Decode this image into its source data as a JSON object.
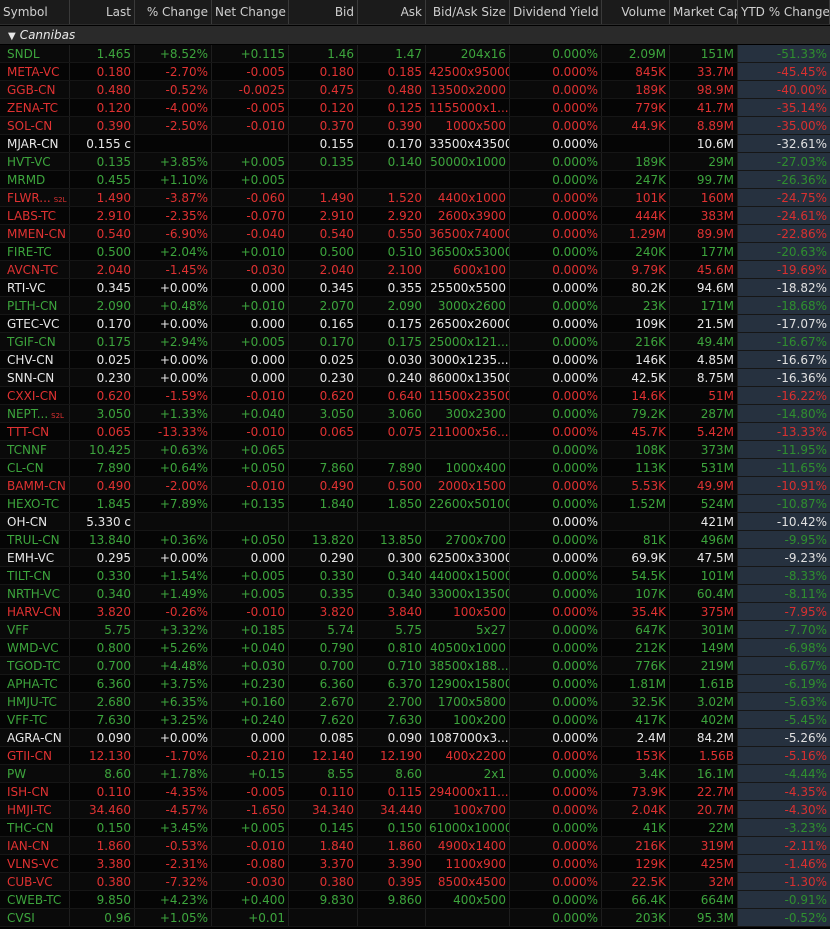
{
  "columns": [
    "Symbol",
    "Last",
    "% Change",
    "Net Change",
    "Bid",
    "Ask",
    "Bid/Ask Size",
    "Dividend Yield",
    "Volume",
    "Market Cap",
    "YTD % Change"
  ],
  "group": {
    "label": "Cannibas",
    "icon": "collapse-triangle-icon"
  },
  "colors": {
    "up": "#3da53d",
    "down": "#e03232",
    "flat": "#e8e8e8",
    "ytd_bg": "#26313f"
  },
  "rows": [
    {
      "s": "SNDL",
      "last": "1.465",
      "pct": "+8.52%",
      "net": "+0.115",
      "bid": "1.46",
      "ask": "1.47",
      "size": "204x16",
      "div": "0.000%",
      "vol": "2.09M",
      "cap": "151M",
      "ytd": "-51.33%",
      "d": "up"
    },
    {
      "s": "META-VC",
      "last": "0.180",
      "pct": "-2.70%",
      "net": "-0.005",
      "bid": "0.180",
      "ask": "0.185",
      "size": "42500x95000",
      "div": "0.000%",
      "vol": "845K",
      "cap": "33.7M",
      "ytd": "-45.45%",
      "d": "dn"
    },
    {
      "s": "GGB-CN",
      "last": "0.480",
      "pct": "-0.52%",
      "net": "-0.0025",
      "bid": "0.475",
      "ask": "0.480",
      "size": "13500x2000",
      "div": "0.000%",
      "vol": "189K",
      "cap": "98.9M",
      "ytd": "-40.00%",
      "d": "dn"
    },
    {
      "s": "ZENA-TC",
      "last": "0.120",
      "pct": "-4.00%",
      "net": "-0.005",
      "bid": "0.120",
      "ask": "0.125",
      "size": "1155000x1...",
      "div": "0.000%",
      "vol": "779K",
      "cap": "41.7M",
      "ytd": "-35.14%",
      "d": "dn"
    },
    {
      "s": "SOL-CN",
      "last": "0.390",
      "pct": "-2.50%",
      "net": "-0.010",
      "bid": "0.370",
      "ask": "0.390",
      "size": "1000x500",
      "div": "0.000%",
      "vol": "44.9K",
      "cap": "8.89M",
      "ytd": "-35.00%",
      "d": "dn"
    },
    {
      "s": "MJAR-CN",
      "last": "0.155 c",
      "pct": "",
      "net": "",
      "bid": "0.155",
      "ask": "0.170",
      "size": "33500x43500",
      "div": "0.000%",
      "vol": "",
      "cap": "10.6M",
      "ytd": "-32.61%",
      "d": "fl"
    },
    {
      "s": "HVT-VC",
      "last": "0.135",
      "pct": "+3.85%",
      "net": "+0.005",
      "bid": "0.135",
      "ask": "0.140",
      "size": "50000x1000",
      "div": "0.000%",
      "vol": "189K",
      "cap": "29M",
      "ytd": "-27.03%",
      "d": "up"
    },
    {
      "s": "MRMD",
      "last": "0.455",
      "pct": "+1.10%",
      "net": "+0.005",
      "bid": "",
      "ask": "",
      "size": "",
      "div": "0.000%",
      "vol": "247K",
      "cap": "99.7M",
      "ytd": "-26.36%",
      "d": "up"
    },
    {
      "s": "FLWR...",
      "tag": "S2L",
      "last": "1.490",
      "pct": "-3.87%",
      "net": "-0.060",
      "bid": "1.490",
      "ask": "1.520",
      "size": "4400x1000",
      "div": "0.000%",
      "vol": "101K",
      "cap": "160M",
      "ytd": "-24.75%",
      "d": "dn"
    },
    {
      "s": "LABS-TC",
      "last": "2.910",
      "pct": "-2.35%",
      "net": "-0.070",
      "bid": "2.910",
      "ask": "2.920",
      "size": "2600x3900",
      "div": "0.000%",
      "vol": "444K",
      "cap": "383M",
      "ytd": "-24.61%",
      "d": "dn"
    },
    {
      "s": "MMEN-CN",
      "last": "0.540",
      "pct": "-6.90%",
      "net": "-0.040",
      "bid": "0.540",
      "ask": "0.550",
      "size": "36500x74000",
      "div": "0.000%",
      "vol": "1.29M",
      "cap": "89.9M",
      "ytd": "-22.86%",
      "d": "dn"
    },
    {
      "s": "FIRE-TC",
      "last": "0.500",
      "pct": "+2.04%",
      "net": "+0.010",
      "bid": "0.500",
      "ask": "0.510",
      "size": "36500x53000",
      "div": "0.000%",
      "vol": "240K",
      "cap": "177M",
      "ytd": "-20.63%",
      "d": "up"
    },
    {
      "s": "AVCN-TC",
      "last": "2.040",
      "pct": "-1.45%",
      "net": "-0.030",
      "bid": "2.040",
      "ask": "2.100",
      "size": "600x100",
      "div": "0.000%",
      "vol": "9.79K",
      "cap": "45.6M",
      "ytd": "-19.69%",
      "d": "dn"
    },
    {
      "s": "RTI-VC",
      "last": "0.345",
      "pct": "+0.00%",
      "net": "0.000",
      "bid": "0.345",
      "ask": "0.355",
      "size": "25500x5500",
      "div": "0.000%",
      "vol": "80.2K",
      "cap": "94.6M",
      "ytd": "-18.82%",
      "d": "fl"
    },
    {
      "s": "PLTH-CN",
      "last": "2.090",
      "pct": "+0.48%",
      "net": "+0.010",
      "bid": "2.070",
      "ask": "2.090",
      "size": "3000x2600",
      "div": "0.000%",
      "vol": "23K",
      "cap": "171M",
      "ytd": "-18.68%",
      "d": "up"
    },
    {
      "s": "GTEC-VC",
      "last": "0.170",
      "pct": "+0.00%",
      "net": "0.000",
      "bid": "0.165",
      "ask": "0.175",
      "size": "26500x26000",
      "div": "0.000%",
      "vol": "109K",
      "cap": "21.5M",
      "ytd": "-17.07%",
      "d": "fl"
    },
    {
      "s": "TGIF-CN",
      "last": "0.175",
      "pct": "+2.94%",
      "net": "+0.005",
      "bid": "0.170",
      "ask": "0.175",
      "size": "25000x121...",
      "div": "0.000%",
      "vol": "216K",
      "cap": "49.4M",
      "ytd": "-16.67%",
      "d": "up"
    },
    {
      "s": "CHV-CN",
      "last": "0.025",
      "pct": "+0.00%",
      "net": "0.000",
      "bid": "0.025",
      "ask": "0.030",
      "size": "3000x1235...",
      "div": "0.000%",
      "vol": "146K",
      "cap": "4.85M",
      "ytd": "-16.67%",
      "d": "fl"
    },
    {
      "s": "SNN-CN",
      "last": "0.230",
      "pct": "+0.00%",
      "net": "0.000",
      "bid": "0.230",
      "ask": "0.240",
      "size": "86000x13500",
      "div": "0.000%",
      "vol": "42.5K",
      "cap": "8.75M",
      "ytd": "-16.36%",
      "d": "fl"
    },
    {
      "s": "CXXI-CN",
      "last": "0.620",
      "pct": "-1.59%",
      "net": "-0.010",
      "bid": "0.620",
      "ask": "0.640",
      "size": "11500x23500",
      "div": "0.000%",
      "vol": "14.6K",
      "cap": "51M",
      "ytd": "-16.22%",
      "d": "dn"
    },
    {
      "s": "NEPT...",
      "tag": "S2L",
      "last": "3.050",
      "pct": "+1.33%",
      "net": "+0.040",
      "bid": "3.050",
      "ask": "3.060",
      "size": "300x2300",
      "div": "0.000%",
      "vol": "79.2K",
      "cap": "287M",
      "ytd": "-14.80%",
      "d": "up"
    },
    {
      "s": "TTT-CN",
      "last": "0.065",
      "pct": "-13.33%",
      "net": "-0.010",
      "bid": "0.065",
      "ask": "0.075",
      "size": "211000x56...",
      "div": "0.000%",
      "vol": "45.7K",
      "cap": "5.42M",
      "ytd": "-13.33%",
      "d": "dn"
    },
    {
      "s": "TCNNF",
      "last": "10.425",
      "pct": "+0.63%",
      "net": "+0.065",
      "bid": "",
      "ask": "",
      "size": "",
      "div": "0.000%",
      "vol": "108K",
      "cap": "373M",
      "ytd": "-11.95%",
      "d": "up"
    },
    {
      "s": "CL-CN",
      "last": "7.890",
      "pct": "+0.64%",
      "net": "+0.050",
      "bid": "7.860",
      "ask": "7.890",
      "size": "1000x400",
      "div": "0.000%",
      "vol": "113K",
      "cap": "531M",
      "ytd": "-11.65%",
      "d": "up"
    },
    {
      "s": "BAMM-CN",
      "last": "0.490",
      "pct": "-2.00%",
      "net": "-0.010",
      "bid": "0.490",
      "ask": "0.500",
      "size": "2000x1500",
      "div": "0.000%",
      "vol": "5.53K",
      "cap": "49.9M",
      "ytd": "-10.91%",
      "d": "dn"
    },
    {
      "s": "HEXO-TC",
      "last": "1.845",
      "pct": "+7.89%",
      "net": "+0.135",
      "bid": "1.840",
      "ask": "1.850",
      "size": "22600x50100",
      "div": "0.000%",
      "vol": "1.52M",
      "cap": "524M",
      "ytd": "-10.87%",
      "d": "up"
    },
    {
      "s": "OH-CN",
      "last": "5.330 c",
      "pct": "",
      "net": "",
      "bid": "",
      "ask": "",
      "size": "",
      "div": "0.000%",
      "vol": "",
      "cap": "421M",
      "ytd": "-10.42%",
      "d": "fl"
    },
    {
      "s": "TRUL-CN",
      "last": "13.840",
      "pct": "+0.36%",
      "net": "+0.050",
      "bid": "13.820",
      "ask": "13.850",
      "size": "2700x700",
      "div": "0.000%",
      "vol": "81K",
      "cap": "496M",
      "ytd": "-9.95%",
      "d": "up"
    },
    {
      "s": "EMH-VC",
      "last": "0.295",
      "pct": "+0.00%",
      "net": "0.000",
      "bid": "0.290",
      "ask": "0.300",
      "size": "62500x33000",
      "div": "0.000%",
      "vol": "69.9K",
      "cap": "47.5M",
      "ytd": "-9.23%",
      "d": "fl"
    },
    {
      "s": "TILT-CN",
      "last": "0.330",
      "pct": "+1.54%",
      "net": "+0.005",
      "bid": "0.330",
      "ask": "0.340",
      "size": "44000x15000",
      "div": "0.000%",
      "vol": "54.5K",
      "cap": "101M",
      "ytd": "-8.33%",
      "d": "up"
    },
    {
      "s": "NRTH-VC",
      "last": "0.340",
      "pct": "+1.49%",
      "net": "+0.005",
      "bid": "0.335",
      "ask": "0.340",
      "size": "33000x13500",
      "div": "0.000%",
      "vol": "107K",
      "cap": "60.4M",
      "ytd": "-8.11%",
      "d": "up"
    },
    {
      "s": "HARV-CN",
      "last": "3.820",
      "pct": "-0.26%",
      "net": "-0.010",
      "bid": "3.820",
      "ask": "3.840",
      "size": "100x500",
      "div": "0.000%",
      "vol": "35.4K",
      "cap": "375M",
      "ytd": "-7.95%",
      "d": "dn"
    },
    {
      "s": "VFF",
      "last": "5.75",
      "pct": "+3.32%",
      "net": "+0.185",
      "bid": "5.74",
      "ask": "5.75",
      "size": "5x27",
      "div": "0.000%",
      "vol": "647K",
      "cap": "301M",
      "ytd": "-7.70%",
      "d": "up"
    },
    {
      "s": "WMD-VC",
      "last": "0.800",
      "pct": "+5.26%",
      "net": "+0.040",
      "bid": "0.790",
      "ask": "0.810",
      "size": "40500x1000",
      "div": "0.000%",
      "vol": "212K",
      "cap": "149M",
      "ytd": "-6.98%",
      "d": "up"
    },
    {
      "s": "TGOD-TC",
      "last": "0.700",
      "pct": "+4.48%",
      "net": "+0.030",
      "bid": "0.700",
      "ask": "0.710",
      "size": "38500x188...",
      "div": "0.000%",
      "vol": "776K",
      "cap": "219M",
      "ytd": "-6.67%",
      "d": "up"
    },
    {
      "s": "APHA-TC",
      "last": "6.360",
      "pct": "+3.75%",
      "net": "+0.230",
      "bid": "6.360",
      "ask": "6.370",
      "size": "12900x15800",
      "div": "0.000%",
      "vol": "1.81M",
      "cap": "1.61B",
      "ytd": "-6.19%",
      "d": "up"
    },
    {
      "s": "HMJU-TC",
      "last": "2.680",
      "pct": "+6.35%",
      "net": "+0.160",
      "bid": "2.670",
      "ask": "2.700",
      "size": "1700x5800",
      "div": "0.000%",
      "vol": "32.5K",
      "cap": "3.02M",
      "ytd": "-5.63%",
      "d": "up"
    },
    {
      "s": "VFF-TC",
      "last": "7.630",
      "pct": "+3.25%",
      "net": "+0.240",
      "bid": "7.620",
      "ask": "7.630",
      "size": "100x200",
      "div": "0.000%",
      "vol": "417K",
      "cap": "402M",
      "ytd": "-5.45%",
      "d": "up"
    },
    {
      "s": "AGRA-CN",
      "last": "0.090",
      "pct": "+0.00%",
      "net": "0.000",
      "bid": "0.085",
      "ask": "0.090",
      "size": "1087000x3...",
      "div": "0.000%",
      "vol": "2.4M",
      "cap": "84.2M",
      "ytd": "-5.26%",
      "d": "fl"
    },
    {
      "s": "GTII-CN",
      "last": "12.130",
      "pct": "-1.70%",
      "net": "-0.210",
      "bid": "12.140",
      "ask": "12.190",
      "size": "400x2200",
      "div": "0.000%",
      "vol": "153K",
      "cap": "1.56B",
      "ytd": "-5.16%",
      "d": "dn"
    },
    {
      "s": "PW",
      "last": "8.60",
      "pct": "+1.78%",
      "net": "+0.15",
      "bid": "8.55",
      "ask": "8.60",
      "size": "2x1",
      "div": "0.000%",
      "vol": "3.4K",
      "cap": "16.1M",
      "ytd": "-4.44%",
      "d": "up"
    },
    {
      "s": "ISH-CN",
      "last": "0.110",
      "pct": "-4.35%",
      "net": "-0.005",
      "bid": "0.110",
      "ask": "0.115",
      "size": "294000x11...",
      "div": "0.000%",
      "vol": "73.9K",
      "cap": "22.7M",
      "ytd": "-4.35%",
      "d": "dn"
    },
    {
      "s": "HMJI-TC",
      "last": "34.460",
      "pct": "-4.57%",
      "net": "-1.650",
      "bid": "34.340",
      "ask": "34.440",
      "size": "100x700",
      "div": "0.000%",
      "vol": "2.04K",
      "cap": "20.7M",
      "ytd": "-4.30%",
      "d": "dn"
    },
    {
      "s": "THC-CN",
      "last": "0.150",
      "pct": "+3.45%",
      "net": "+0.005",
      "bid": "0.145",
      "ask": "0.150",
      "size": "61000x10000",
      "div": "0.000%",
      "vol": "41K",
      "cap": "22M",
      "ytd": "-3.23%",
      "d": "up"
    },
    {
      "s": "IAN-CN",
      "last": "1.860",
      "pct": "-0.53%",
      "net": "-0.010",
      "bid": "1.840",
      "ask": "1.860",
      "size": "4900x1400",
      "div": "0.000%",
      "vol": "216K",
      "cap": "319M",
      "ytd": "-2.11%",
      "d": "dn"
    },
    {
      "s": "VLNS-VC",
      "last": "3.380",
      "pct": "-2.31%",
      "net": "-0.080",
      "bid": "3.370",
      "ask": "3.390",
      "size": "1100x900",
      "div": "0.000%",
      "vol": "129K",
      "cap": "425M",
      "ytd": "-1.46%",
      "d": "dn"
    },
    {
      "s": "CUB-VC",
      "last": "0.380",
      "pct": "-7.32%",
      "net": "-0.030",
      "bid": "0.380",
      "ask": "0.395",
      "size": "8500x4500",
      "div": "0.000%",
      "vol": "22.5K",
      "cap": "32M",
      "ytd": "-1.30%",
      "d": "dn"
    },
    {
      "s": "CWEB-TC",
      "last": "9.850",
      "pct": "+4.23%",
      "net": "+0.400",
      "bid": "9.830",
      "ask": "9.860",
      "size": "400x500",
      "div": "0.000%",
      "vol": "66.4K",
      "cap": "664M",
      "ytd": "-0.91%",
      "d": "up"
    },
    {
      "s": "CVSI",
      "last": "0.96",
      "pct": "+1.05%",
      "net": "+0.01",
      "bid": "",
      "ask": "",
      "size": "",
      "div": "0.000%",
      "vol": "203K",
      "cap": "95.3M",
      "ytd": "-0.52%",
      "d": "up"
    }
  ]
}
